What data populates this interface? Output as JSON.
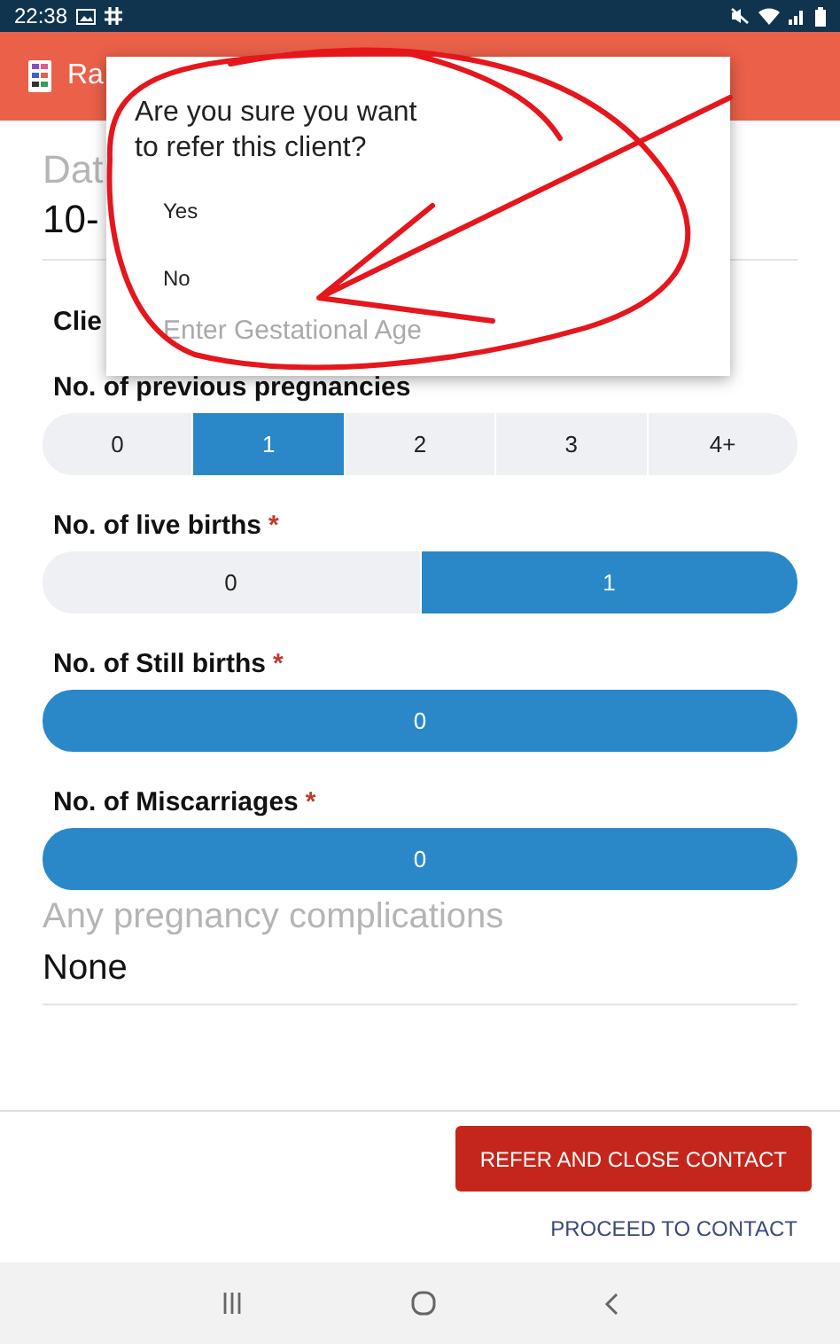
{
  "status_bar": {
    "time": "22:38"
  },
  "app_bar": {
    "title": "Ra"
  },
  "form": {
    "date_label": "Dat",
    "date_value": "10-",
    "section_title": "Clie"
  },
  "groups": [
    {
      "label": "No. of previous pregnancies",
      "required": false,
      "options": [
        {
          "label": "0",
          "selected": false
        },
        {
          "label": "1",
          "selected": true
        },
        {
          "label": "2",
          "selected": false
        },
        {
          "label": "3",
          "selected": false
        },
        {
          "label": "4+",
          "selected": false
        }
      ]
    },
    {
      "label": "No. of live births",
      "required": true,
      "options": [
        {
          "label": "0",
          "selected": false
        },
        {
          "label": "1",
          "selected": true
        }
      ]
    },
    {
      "label": "No. of Still  births",
      "required": true,
      "options": [
        {
          "label": "0",
          "selected": true
        }
      ]
    },
    {
      "label": "No. of Miscarriages",
      "required": true,
      "options": [
        {
          "label": "0",
          "selected": true
        }
      ]
    }
  ],
  "required_mark": "*",
  "complications": {
    "label": "Any pregnancy complications",
    "value": "None"
  },
  "footer": {
    "primary_button": "REFER AND CLOSE CONTACT",
    "secondary_link": "PROCEED TO CONTACT"
  },
  "dialog": {
    "message": "Are you sure you want to refer this client?",
    "options": [
      "Yes",
      "No"
    ],
    "input_placeholder": "Enter Gestational Age"
  },
  "annotation": {
    "kind": "scribble"
  }
}
